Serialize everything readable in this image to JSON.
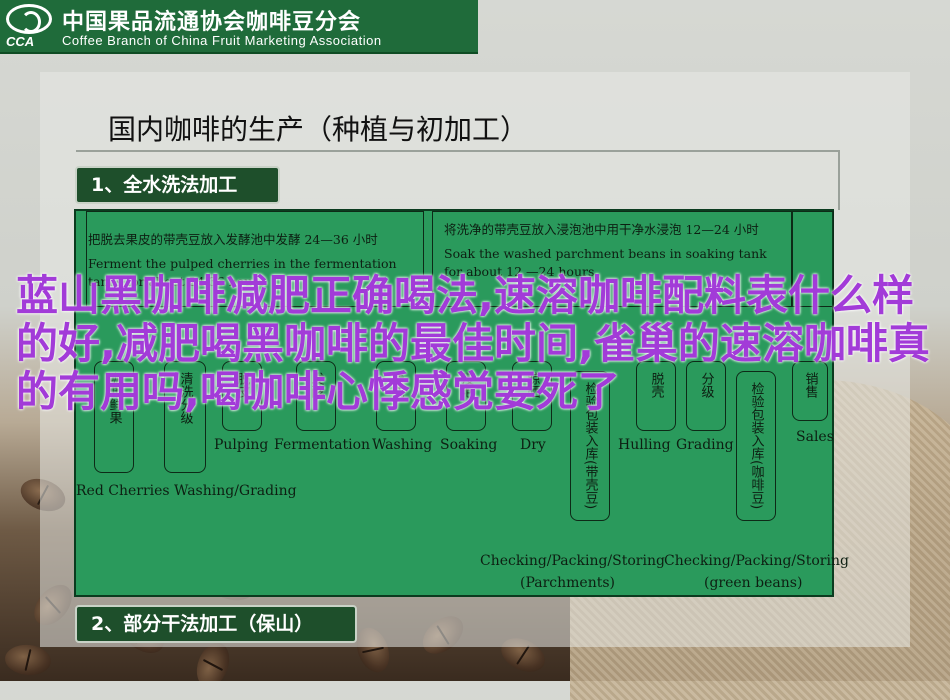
{
  "header": {
    "org_cn": "中国果品流通协会咖啡豆分会",
    "org_logo_text": "CCA",
    "org_en": "Coffee Branch of China Fruit Marketing Association"
  },
  "slide": {
    "title": "国内咖啡的生产（种植与初加工）",
    "section1": "1、全水洗法加工",
    "section2": "2、部分干法加工（保山）"
  },
  "diagram": {
    "note1_cn": "把脱去果皮的带壳豆放入发酵池中发酵 24—36 小时",
    "note1_en": "Ferment the pulped cherries in the fermentation tanks for about 24-36 hours",
    "note2_cn": "将洗净的带壳豆放入浸泡池中用干净水浸泡 12—24 小时",
    "note2_en": "Soak the washed parchment beans in soaking tank for about 12 —24 hours",
    "steps_vertical": [
      "咖啡鲜果",
      "清洗分级",
      "脱皮",
      "发酵",
      "清洗",
      "浸泡",
      "晾晒",
      "检验包装入库(带壳豆)",
      "脱壳",
      "分级",
      "检验包装入库(咖啡豆)",
      "销售"
    ],
    "labels": {
      "pulping": "Pulping",
      "fermentation": "Fermentation",
      "washing": "Washing",
      "soaking": "Soaking",
      "dry": "Dry",
      "hulling": "Hulling",
      "grading": "Grading",
      "sales": "Sales",
      "red_cherries": "Red Cherries Washing/Grading",
      "checking1": "Checking/Packing/Storing",
      "checking1_sub": "(Parchments)",
      "checking2": "Checking/Packing/Storing",
      "checking2_sub": "(green beans)"
    }
  },
  "overlay_text": "蓝山黑咖啡减肥正确喝法,速溶咖啡配料表什么样的好,减肥喝黑咖啡的最佳时间,雀巢的速溶咖啡真的有用吗,喝咖啡心悸感觉要死了"
}
